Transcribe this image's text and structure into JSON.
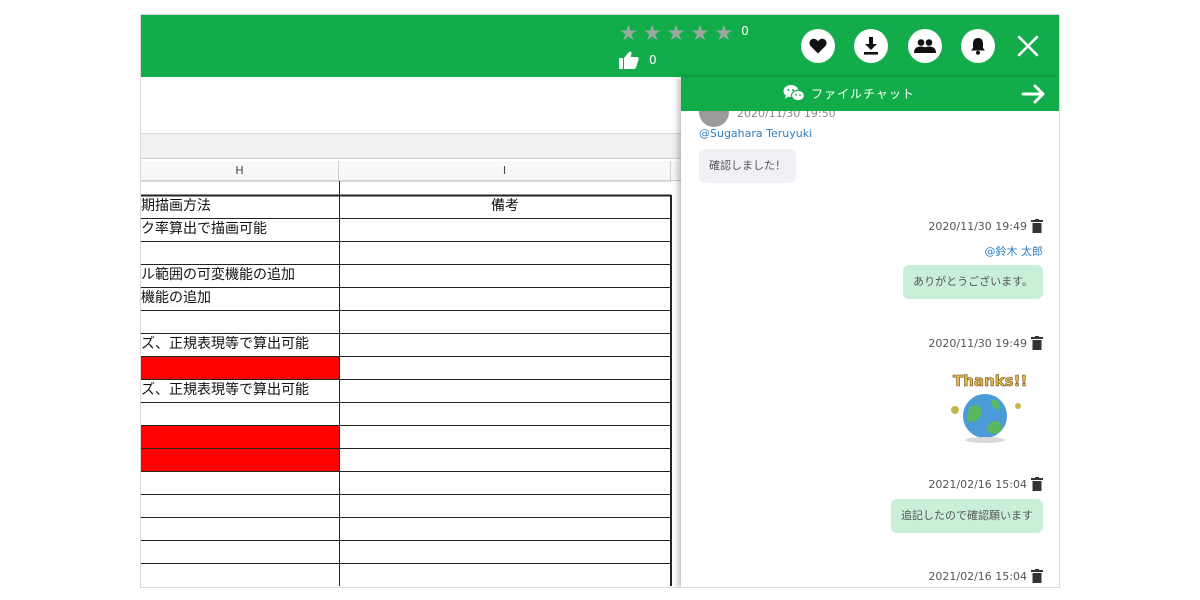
{
  "topbar": {
    "rating": {
      "stars": 5,
      "filled": 0,
      "count": "0"
    },
    "likes": {
      "count": "0"
    },
    "actions": [
      "heart-icon",
      "download-icon",
      "users-icon",
      "bell-icon",
      "close-icon"
    ]
  },
  "sheet": {
    "columns": [
      "H",
      "I"
    ],
    "rows": [
      {
        "h": "",
        "i": "",
        "h_red": false
      },
      {
        "h": "期描画方法",
        "i": "備考",
        "h_red": false
      },
      {
        "h": "ク率算出で描画可能",
        "i": "",
        "h_red": false
      },
      {
        "h": "",
        "i": "",
        "h_red": false
      },
      {
        "h": "ル範囲の可変機能の追加",
        "i": "",
        "h_red": false
      },
      {
        "h": "機能の追加",
        "i": "",
        "h_red": false
      },
      {
        "h": "",
        "i": "",
        "h_red": false
      },
      {
        "h": "ズ、正規表現等で算出可能",
        "i": "",
        "h_red": false
      },
      {
        "h": "",
        "i": "",
        "h_red": true
      },
      {
        "h": "ズ、正規表現等で算出可能",
        "i": "",
        "h_red": false
      },
      {
        "h": "",
        "i": "",
        "h_red": false
      },
      {
        "h": "",
        "i": "",
        "h_red": true
      },
      {
        "h": "",
        "i": "",
        "h_red": true
      },
      {
        "h": "",
        "i": "",
        "h_red": false
      },
      {
        "h": "",
        "i": "",
        "h_red": false
      },
      {
        "h": "",
        "i": "",
        "h_red": false
      },
      {
        "h": "",
        "i": "",
        "h_red": false
      },
      {
        "h": "",
        "i": "",
        "h_red": false
      }
    ]
  },
  "chat": {
    "title": "ファイルチャット",
    "cut_timestamp": "2020/11/30 19:50",
    "messages": [
      {
        "mention": "@Sugahara Teruyuki",
        "text": "確認しました！"
      },
      {
        "timestamp": "2020/11/30 19:49",
        "mention": "@鈴木 太郎",
        "text": "ありがとうございます。"
      },
      {
        "timestamp": "2020/11/30 19:49",
        "sticker": "Thanks!!"
      },
      {
        "timestamp": "2021/02/16 15:04",
        "text": "追記したので確認願います"
      },
      {
        "timestamp": "2021/02/16 15:04"
      }
    ]
  },
  "colors": {
    "accent": "#12ad4a",
    "highlight_cell": "#ff0000",
    "mention": "#2d7fc1",
    "bubble_green": "#c9f0d6"
  }
}
